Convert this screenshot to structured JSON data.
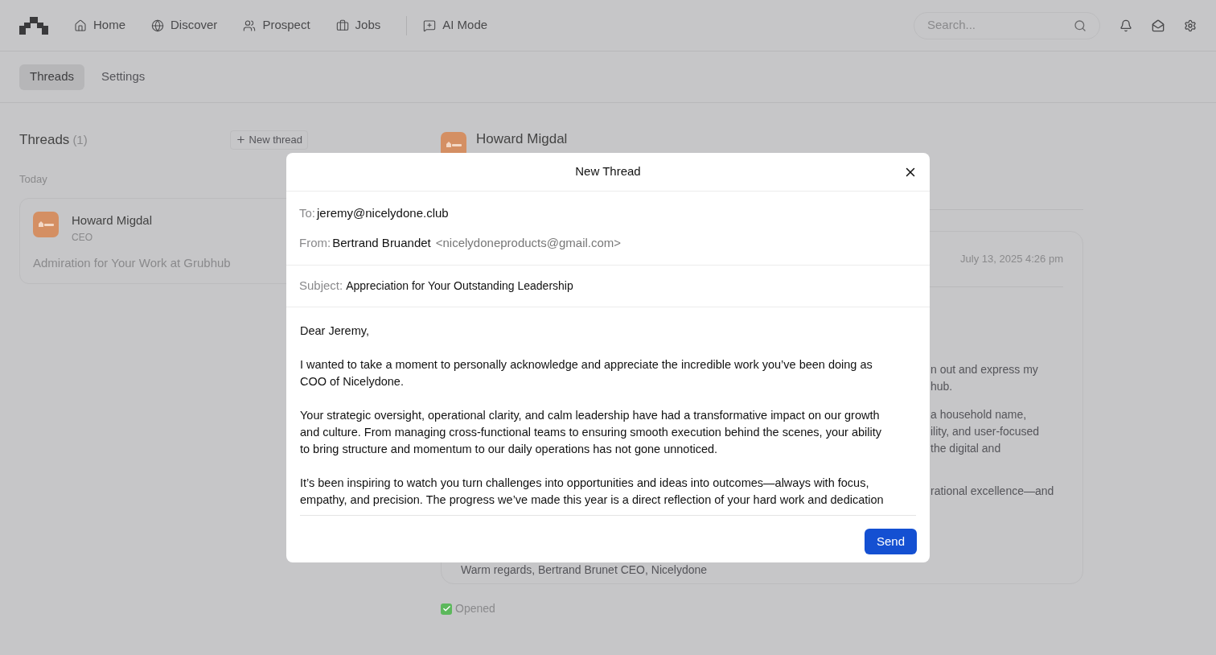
{
  "nav": {
    "items": [
      {
        "label": "Home"
      },
      {
        "label": "Discover"
      },
      {
        "label": "Prospect"
      },
      {
        "label": "Jobs"
      },
      {
        "label": "AI Mode"
      }
    ],
    "search": {
      "placeholder": "Search..."
    }
  },
  "tabs": [
    {
      "label": "Threads",
      "selected": true
    },
    {
      "label": "Settings",
      "selected": false
    }
  ],
  "threads": {
    "title": "Threads",
    "count": "(1)",
    "new_button": "New thread",
    "group": "Today",
    "items": [
      {
        "name": "Howard Migdal",
        "role": "CEO",
        "subject": "Admiration for Your Work at Grubhub"
      }
    ]
  },
  "conversation": {
    "name": "Howard Migdal",
    "date": "July 13, 2025 4:26 pm",
    "fragments": [
      [
        "n out and express my",
        "hub."
      ],
      [
        "a household name,",
        "ility, and user-focused",
        "the digital and"
      ],
      [
        "rational excellence—and"
      ]
    ],
    "signature": "Warm regards, Bertrand Brunet CEO, Nicelydone",
    "status": "Opened"
  },
  "modal": {
    "title": "New Thread",
    "to_label": "To:",
    "to": "jeremy@nicelydone.club",
    "from_label": "From:",
    "from_name": "Bertrand Bruandet",
    "from_email": "<nicelydoneproducts@gmail.com>",
    "subject_label": "Subject:",
    "subject": "Appreciation for Your Outstanding Leadership",
    "body": [
      "Dear Jeremy,",
      "I wanted to take a moment to personally acknowledge and appreciate the incredible work you’ve been doing as COO of Nicelydone.",
      "Your strategic oversight, operational clarity, and calm leadership have had a transformative impact on our growth and culture. From managing cross-functional teams to ensuring smooth execution behind the scenes, your ability to bring structure and momentum to our daily operations has not gone unnoticed.",
      "It’s been inspiring to watch you turn challenges into opportunities and ideas into outcomes—always with focus, empathy, and precision. The progress we’ve made this year is a direct reflection of your hard work and dedication"
    ],
    "send": "Send"
  }
}
